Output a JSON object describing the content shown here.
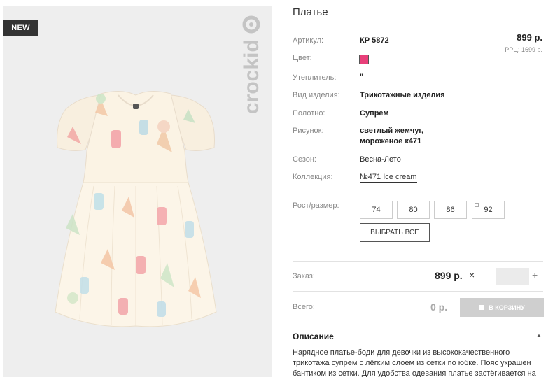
{
  "product": {
    "badge": "NEW",
    "brand_logo_text": "crockid",
    "title": "Платье",
    "price": "899 р.",
    "rrp": "РРЦ: 1699 р."
  },
  "attributes": {
    "article": {
      "label": "Артикул:",
      "value": "КР 5872"
    },
    "color": {
      "label": "Цвет:",
      "swatch": "#e8407a"
    },
    "insulation": {
      "label": "Утеплитель:",
      "value": "\""
    },
    "product_type": {
      "label": "Вид изделия:",
      "value": "Трикотажные изделия"
    },
    "fabric": {
      "label": "Полотно:",
      "value": "Супрем"
    },
    "pattern": {
      "label": "Рисунок:",
      "value_line1": "светлый жемчуг,",
      "value_line2": "мороженое к471"
    },
    "season": {
      "label": "Сезон:",
      "value": "Весна-Лето"
    },
    "collection": {
      "label": "Коллекция:",
      "value": "№471 Ice cream"
    }
  },
  "sizes": {
    "label": "Рост/размер:",
    "options": [
      "74",
      "80",
      "86",
      "92"
    ],
    "select_all": "ВЫБРАТЬ ВСЕ"
  },
  "order": {
    "label": "Заказ:",
    "price": "899 р.",
    "multiply": "×",
    "minus": "–",
    "plus": "+",
    "quantity": ""
  },
  "total": {
    "label": "Всего:",
    "value": "0 р.",
    "cart_button": "В КОРЗИНУ"
  },
  "description": {
    "title": "Описание",
    "toggle": "▲",
    "text": "Нарядное платье-боди для девочки из высококачественного трикотажа супрем с лёгким слоем из сетки по юбке. Пояс украшен бантиком из сетки. Для удобства одевания платье застёгивается на"
  },
  "icons": {
    "cart": "cart-icon",
    "collapse": "chevron-up-icon"
  },
  "colors": {
    "accent_swatch": "#e8407a",
    "badge_bg": "#333333",
    "cart_disabled": "#cfcfcf"
  }
}
